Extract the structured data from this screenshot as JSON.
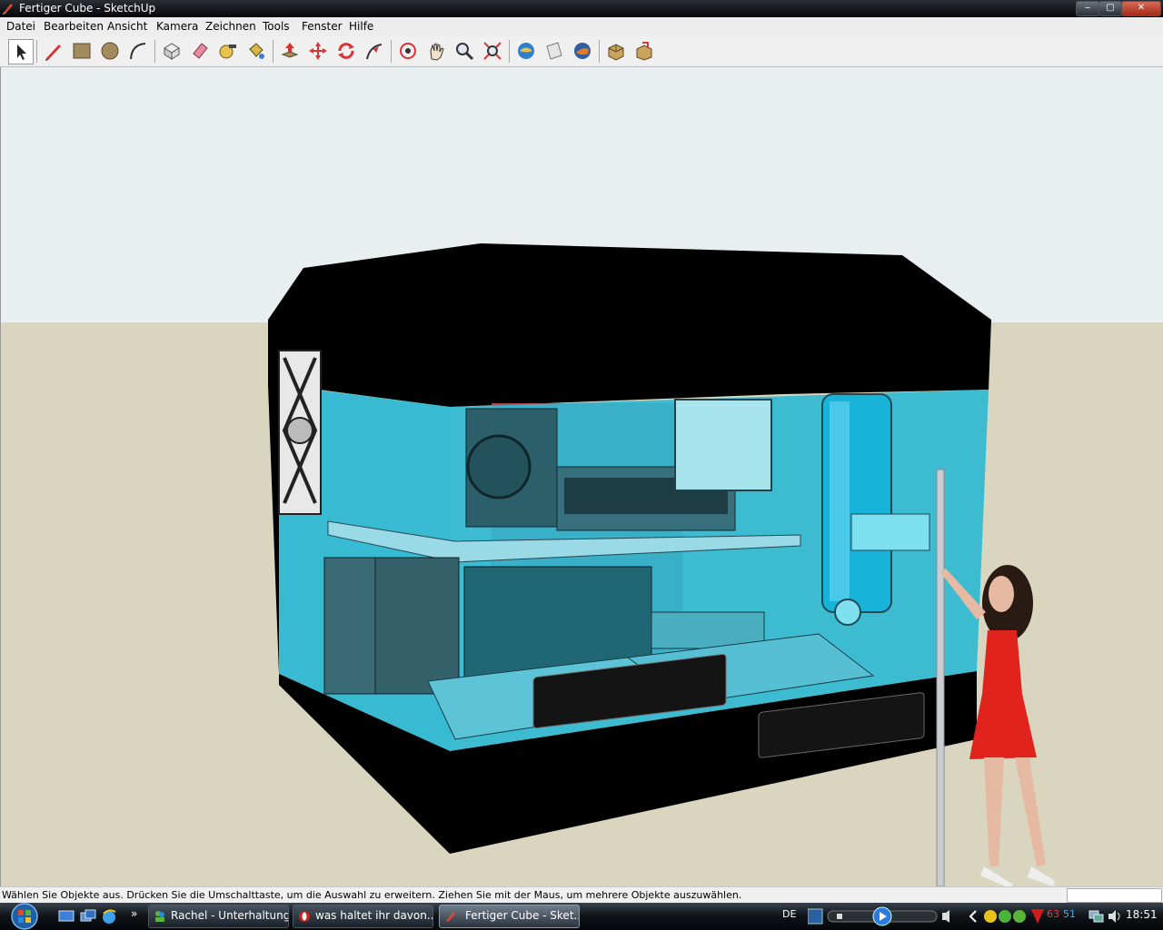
{
  "window": {
    "title": "Fertiger Cube - SketchUp",
    "controls": {
      "minimize": "‒",
      "maximize": "▢",
      "close": "✕"
    }
  },
  "menu": [
    "Datei",
    "Bearbeiten",
    "Ansicht",
    "Kamera",
    "Zeichnen",
    "Tools",
    "Fenster",
    "Hilfe"
  ],
  "toolbar": {
    "tools": [
      {
        "name": "select-tool-icon",
        "selected": true
      },
      {
        "name": "pencil-line-tool-icon"
      },
      {
        "name": "rectangle-tool-icon"
      },
      {
        "name": "circle-tool-icon"
      },
      {
        "name": "arc-tool-icon"
      },
      {
        "name": "make-component-tool-icon"
      },
      {
        "name": "eraser-tool-icon"
      },
      {
        "name": "tape-measure-tool-icon"
      },
      {
        "name": "paint-bucket-tool-icon"
      },
      {
        "name": "push-pull-tool-icon"
      },
      {
        "name": "move-tool-icon"
      },
      {
        "name": "rotate-tool-icon"
      },
      {
        "name": "follow-me-tool-icon"
      },
      {
        "name": "orbit-tool-icon"
      },
      {
        "name": "pan-tool-icon"
      },
      {
        "name": "zoom-tool-icon"
      },
      {
        "name": "zoom-extents-tool-icon"
      },
      {
        "name": "get-current-view-icon"
      },
      {
        "name": "section-plane-tool-icon"
      },
      {
        "name": "google-earth-toggle-icon"
      },
      {
        "name": "get-models-icon"
      },
      {
        "name": "share-model-icon"
      }
    ]
  },
  "scene": {
    "sky_color": "#e9eef0",
    "ground_color": "#d9d5bf",
    "case_color": "#000000",
    "glass_color": "#2fb8d3",
    "back_wall_color": "#b04a4f",
    "figure_dress_color": "#e0231c"
  },
  "status": {
    "message": "Wählen Sie Objekte aus. Drücken Sie die Umschalttaste, um die Auswahl zu erweitern. Ziehen Sie mit der Maus, um mehrere Objekte auszuwählen.",
    "measurements_value": ""
  },
  "taskbar": {
    "quick_launch_more": "»",
    "buttons": [
      {
        "label": "Rachel - Unterhaltung",
        "icon": "messenger-icon",
        "active": false
      },
      {
        "label": "was haltet ihr davon...",
        "icon": "opera-browser-icon",
        "active": false
      },
      {
        "label": "Fertiger Cube - Sket...",
        "icon": "sketchup-icon",
        "active": true
      }
    ],
    "language": "DE",
    "clock": "18:51",
    "tray_meter_a": "63",
    "tray_meter_b": "51"
  }
}
